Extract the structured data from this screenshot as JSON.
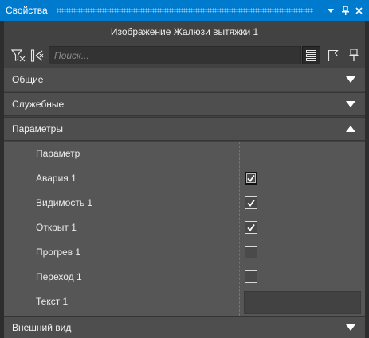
{
  "window": {
    "title": "Свойства",
    "controls": [
      "dropdown-icon",
      "pin-icon",
      "close-icon"
    ]
  },
  "object_title": "Изображение Жалюзи вытяжки 1",
  "toolbar": {
    "left_buttons": [
      "filter-icon",
      "reset-icon"
    ],
    "search_placeholder": "Поиск...",
    "search_value": "",
    "right_buttons": [
      "list-view-icon",
      "flag-icon",
      "pin-property-icon"
    ],
    "active_button": "list-view-icon"
  },
  "sections": [
    {
      "label": "Общие",
      "state": "collapsed"
    },
    {
      "label": "Служебные",
      "state": "collapsed"
    },
    {
      "label": "Параметры",
      "state": "expanded"
    },
    {
      "label": "Внешний вид",
      "state": "collapsed"
    }
  ],
  "parameters": {
    "header": "Параметр",
    "rows": [
      {
        "label": "Авария 1",
        "type": "checkbox",
        "checked": true,
        "focused": true
      },
      {
        "label": "Видимость 1",
        "type": "checkbox",
        "checked": true
      },
      {
        "label": "Открыт 1",
        "type": "checkbox",
        "checked": true
      },
      {
        "label": "Прогрев 1",
        "type": "checkbox",
        "checked": false
      },
      {
        "label": "Переход 1",
        "type": "checkbox",
        "checked": false
      },
      {
        "label": "Текст 1",
        "type": "text",
        "value": ""
      }
    ]
  },
  "colors": {
    "titlebar": "#007acc",
    "panel": "#424242",
    "section_header": "#4e4e4e",
    "property_area": "#565656"
  }
}
